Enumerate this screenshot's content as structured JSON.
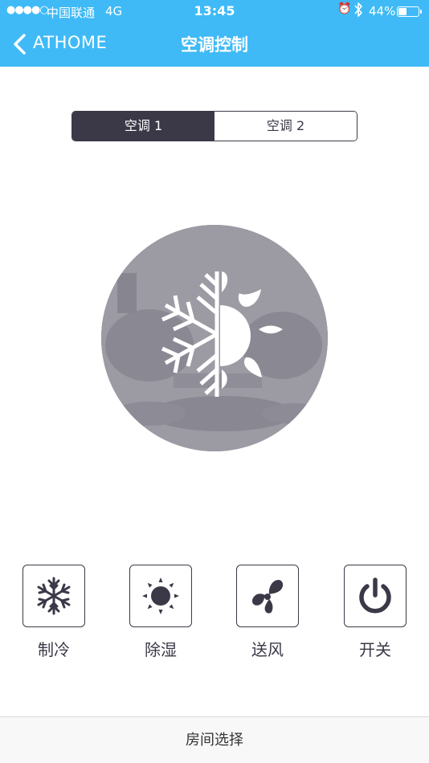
{
  "status_bar": {
    "signal": "●●●●○",
    "carrier": "中国联通",
    "network": "4G",
    "time": "13:45",
    "alarm_icon": "alarm-clock-icon",
    "bluetooth_icon": "bluetooth-icon",
    "battery_percent": "44%",
    "battery_level": 0.44
  },
  "nav": {
    "back_label": "ATHOME",
    "title": "空调控制"
  },
  "segments": [
    {
      "label": "空调 1",
      "active": true
    },
    {
      "label": "空调 2",
      "active": false
    }
  ],
  "hero": {
    "icon": "snowflake-sun-icon"
  },
  "modes": [
    {
      "label": "制冷",
      "icon": "snowflake-icon"
    },
    {
      "label": "除湿",
      "icon": "sun-icon"
    },
    {
      "label": "送风",
      "icon": "fan-icon"
    },
    {
      "label": "开关",
      "icon": "power-icon"
    }
  ],
  "bottom_bar": {
    "label": "房间选择"
  },
  "colors": {
    "header_bg": "#3fbaf6",
    "primary_dark": "#3b3947",
    "hero_bg": "#9998a1"
  }
}
